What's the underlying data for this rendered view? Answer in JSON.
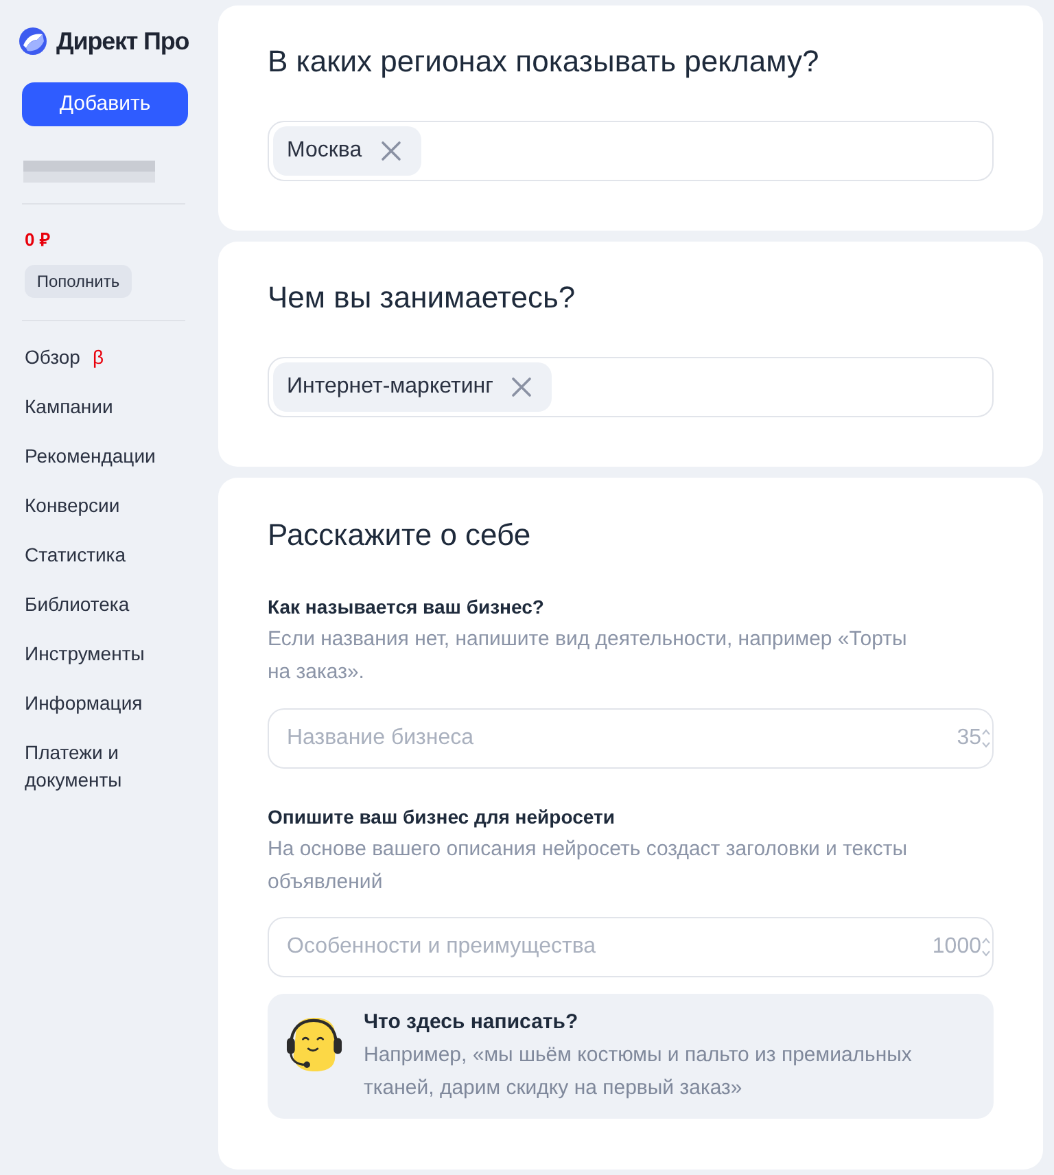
{
  "sidebar": {
    "logo_text": "Директ Про",
    "add_button": "Добавить",
    "balance": "0 ₽",
    "top_up_button": "Пополнить",
    "nav": [
      {
        "label": "Обзор",
        "badge": "β"
      },
      {
        "label": "Кампании"
      },
      {
        "label": "Рекомендации"
      },
      {
        "label": "Конверсии"
      },
      {
        "label": "Статистика"
      },
      {
        "label": "Библиотека"
      },
      {
        "label": "Инструменты"
      },
      {
        "label": "Информация"
      },
      {
        "label": "Платежи и документы"
      }
    ]
  },
  "sections": [
    {
      "kind": "tags",
      "title": "В каких регионах показывать рекламу?",
      "tags": [
        "Москва"
      ]
    },
    {
      "kind": "tags",
      "title": "Чем вы занимаетесь?",
      "tags": [
        "Интернет-маркетинг"
      ]
    },
    {
      "kind": "about",
      "title": "Расскажите о себе",
      "fields": [
        {
          "label": "Как называется ваш бизнес?",
          "hint": "Если названия нет, напишите вид деятельности, например «Торты на заказ».",
          "placeholder": "Название бизнеса",
          "counter": "35"
        },
        {
          "label": "Опишите ваш бизнес для нейросети",
          "hint": "На основе вашего описания нейросеть создаст заголовки и тексты объявлений",
          "placeholder": "Особенности и преимущества",
          "counter": "1000"
        }
      ],
      "tip": {
        "title": "Что здесь написать?",
        "text": "Например, «мы шьём костюмы и пальто из премиальных тканей, дарим скидку на первый заказ»"
      }
    }
  ]
}
